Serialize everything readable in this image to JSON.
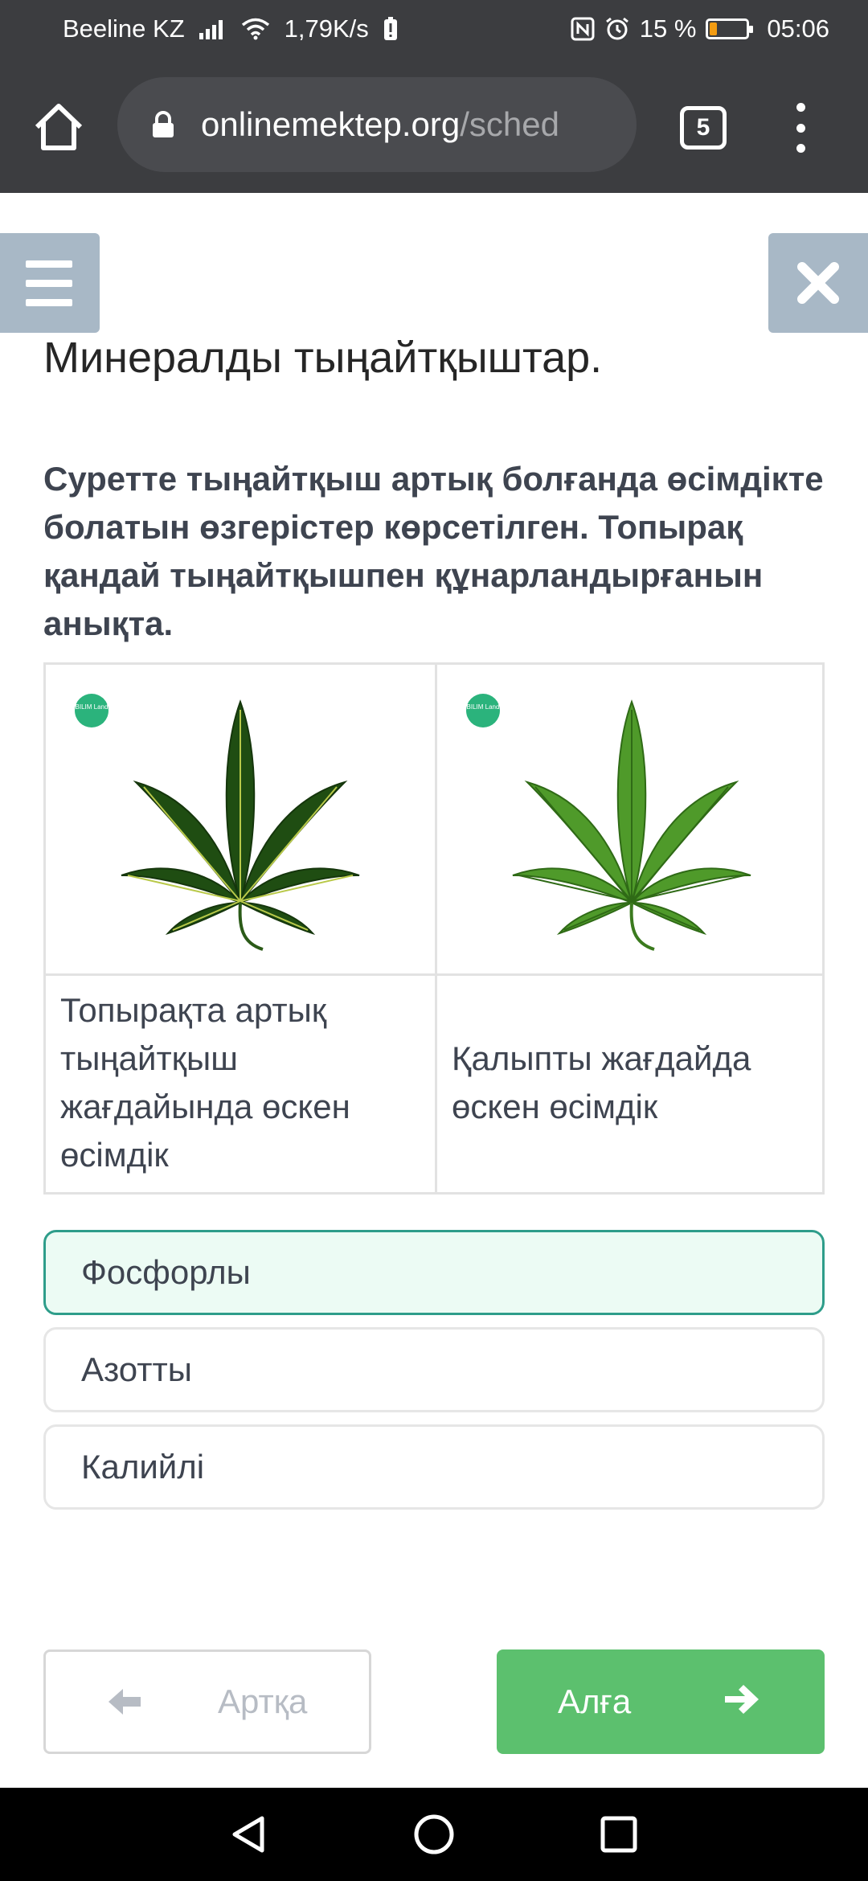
{
  "status_bar": {
    "carrier": "Beeline KZ",
    "speed": "1,79K/s",
    "battery_percent": "15 %",
    "time": "05:06",
    "battery_level": 0.15
  },
  "browser": {
    "url_domain": "onlinemektep.org",
    "url_path": "/sched",
    "tab_count": "5"
  },
  "lesson": {
    "title": "Минералды тыңайтқыштар.",
    "question": "Суретте тыңайтқыш артық болғанда өсімдікте болатын өзгерістер көрсетілген. Топырақ қандай тыңайтқышпен құнарландырғанын анықта."
  },
  "table": {
    "badge_text": "BILIM Land",
    "captions": [
      "Топырақта артық тыңайтқыш жағдайында өскен өсімдік",
      "Қалыпты жағдайда өскен өсімдік"
    ]
  },
  "options": [
    {
      "label": "Фосфорлы",
      "selected": true
    },
    {
      "label": "Азотты",
      "selected": false
    },
    {
      "label": "Калийлі",
      "selected": false
    }
  ],
  "navigation": {
    "back_label": "Артқа",
    "next_label": "Алға"
  },
  "colors": {
    "accent_green": "#5cc06e",
    "selected_border": "#2e9d8a",
    "dark_leaf": "#1f4d12",
    "normal_leaf": "#4f9a2a"
  }
}
